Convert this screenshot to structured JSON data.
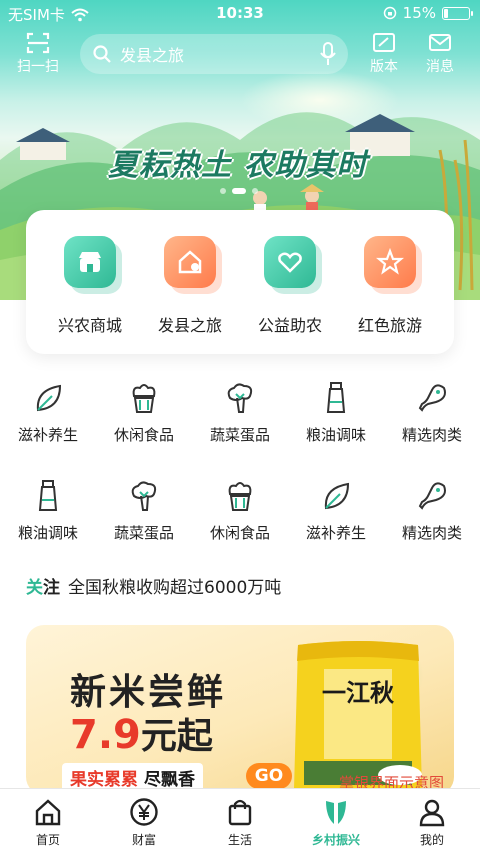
{
  "status_bar": {
    "carrier": "无SIM卡",
    "time": "10:33",
    "battery": "15%",
    "battery_level": 0.15
  },
  "top_bar": {
    "scan_label": "扫一扫",
    "search_placeholder": "发县之旅",
    "version_label": "版本",
    "message_label": "消息"
  },
  "banner": {
    "title": "夏耘热土 农助其时",
    "slide_count": 3,
    "active_slide": 1
  },
  "features": [
    {
      "label": "兴农商城",
      "icon": "shop-icon",
      "color": "green"
    },
    {
      "label": "发县之旅",
      "icon": "home-location-icon",
      "color": "orange"
    },
    {
      "label": "公益助农",
      "icon": "heart-hands-icon",
      "color": "green"
    },
    {
      "label": "红色旅游",
      "icon": "star-icon",
      "color": "orange"
    }
  ],
  "categories_row1": [
    {
      "label": "滋补养生",
      "icon": "leaf-icon"
    },
    {
      "label": "休闲食品",
      "icon": "cupcake-icon"
    },
    {
      "label": "蔬菜蛋品",
      "icon": "broccoli-icon"
    },
    {
      "label": "粮油调味",
      "icon": "oil-bottle-icon"
    },
    {
      "label": "精选肉类",
      "icon": "drumstick-icon"
    }
  ],
  "categories_row2": [
    {
      "label": "粮油调味",
      "icon": "oil-bottle-icon"
    },
    {
      "label": "蔬菜蛋品",
      "icon": "broccoli-icon"
    },
    {
      "label": "休闲食品",
      "icon": "cupcake-icon"
    },
    {
      "label": "滋补养生",
      "icon": "leaf-icon"
    },
    {
      "label": "精选肉类",
      "icon": "drumstick-icon"
    }
  ],
  "news": {
    "tag_prefix": "关",
    "tag_suffix": "注",
    "text": "全国秋粮收购超过6000万吨"
  },
  "promo": {
    "title": "新米尝鲜",
    "price_num": "7.9",
    "price_unit": "元起",
    "slogan_a": "果实累累",
    "slogan_b": "尽飘香",
    "go": "GO",
    "product_name": "一江秋",
    "watermark": "掌银界面示意图"
  },
  "bottom_nav": [
    {
      "label": "首页",
      "icon": "home-icon"
    },
    {
      "label": "财富",
      "icon": "yen-icon"
    },
    {
      "label": "生活",
      "icon": "shopping-bag-icon"
    },
    {
      "label": "乡村振兴",
      "icon": "rural-leaf-icon",
      "active": true
    },
    {
      "label": "我的",
      "icon": "user-icon"
    }
  ],
  "colors": {
    "accent": "#2fb894",
    "orange": "#ff7b4b",
    "red": "#e83a2a"
  }
}
